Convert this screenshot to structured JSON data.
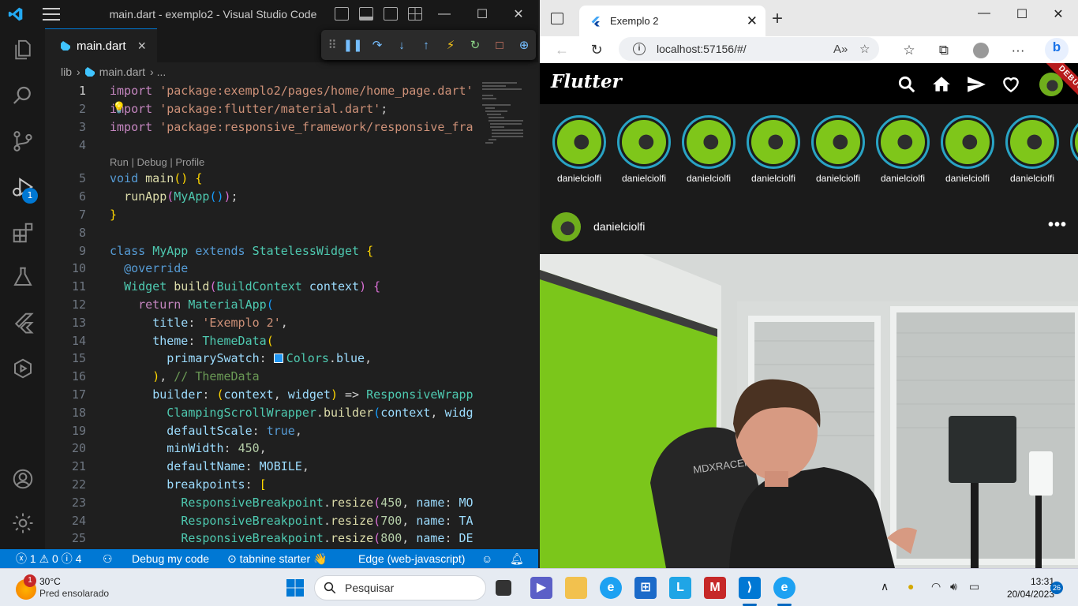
{
  "vscode": {
    "window_title": "main.dart - exemplo2 - Visual Studio Code",
    "debug_badge": "1",
    "tab": {
      "label": "main.dart",
      "close": "×"
    },
    "breadcrumb": {
      "folder": "lib",
      "sep": "›",
      "file": "main.dart",
      "rest": "› ..."
    },
    "codelens": "Run | Debug | Profile",
    "status": {
      "errors": "1",
      "warnings": "0",
      "infos": "4",
      "debug_config": "Debug my code",
      "tabnine": "tabnine starter",
      "device": "Edge (web-javascript)"
    }
  },
  "edge": {
    "tab_title": "Exemplo 2",
    "url": "localhost:57156/#/",
    "app": {
      "logo": "Flutter",
      "debug_banner": "DEBUG",
      "stories": [
        "danielciolfi",
        "danielciolfi",
        "danielciolfi",
        "danielciolfi",
        "danielciolfi",
        "danielciolfi",
        "danielciolfi",
        "danielciolfi"
      ],
      "partial_story": "d",
      "post_user": "danielciolfi",
      "post_more": "•••"
    }
  },
  "taskbar": {
    "weather_temp": "30°C",
    "weather_desc": "Pred ensolarado",
    "weather_badge": "1",
    "search_placeholder": "Pesquisar",
    "time": "13:31",
    "date": "20/04/2023",
    "notifications": "26"
  },
  "colors": {
    "vscode_accent": "#0078d4",
    "flutter_story_ring": "#29a3c4",
    "debug_ribbon": "#b71c1c"
  }
}
